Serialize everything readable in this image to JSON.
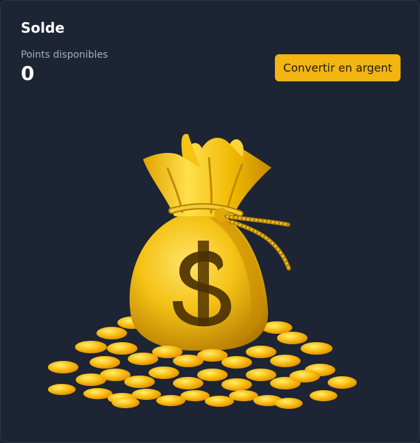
{
  "card": {
    "title": "Solde",
    "points_label": "Points disponibles",
    "points_value": "0",
    "convert_label": "Convertir en argent"
  },
  "illustration": {
    "icon": "money-bag-icon",
    "colors": {
      "gold": "#f2b511",
      "accent": "#ffd640",
      "shadow": "#a86d00",
      "background": "#1d2433"
    }
  }
}
